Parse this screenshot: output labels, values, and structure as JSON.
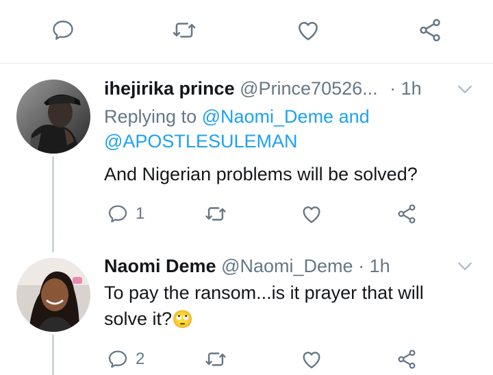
{
  "main_tweet_actions": {
    "reply_icon": "reply-icon",
    "retweet_icon": "retweet-icon",
    "like_icon": "like-icon",
    "share_icon": "share-icon"
  },
  "replies": [
    {
      "name": "ihejirika prince",
      "handle": "@Prince70526...",
      "time": "· 1h",
      "replying_prefix": "Replying to",
      "replying_to_1": "@Naomi_Deme",
      "replying_and": "and",
      "replying_to_2": "@APOSTLESULEMAN",
      "text": "And Nigerian problems will be solved?",
      "reply_count": "1"
    },
    {
      "name": "Naomi Deme",
      "handle": "@Naomi_Deme",
      "time": "· 1h",
      "text_line1": "To pay the ransom...is it prayer that will",
      "text_line2": "solve it?",
      "emoji": "🙄",
      "reply_count": "2"
    }
  ],
  "colors": {
    "accent": "#1da1f2",
    "secondary_text": "#657786",
    "icon": "#657786",
    "thread_line": "#ccd6dd"
  }
}
